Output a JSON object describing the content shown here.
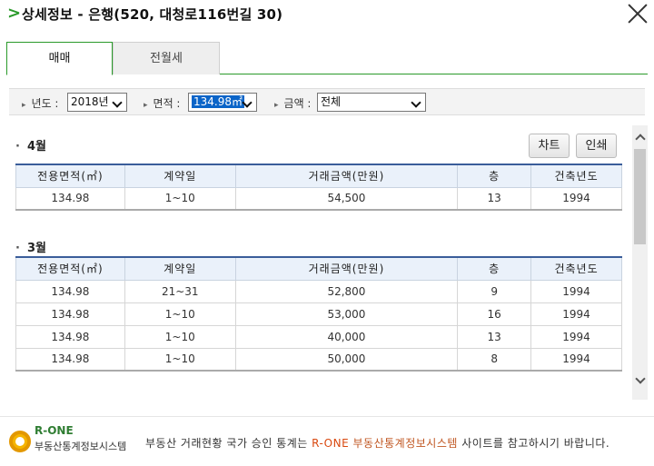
{
  "header": {
    "title": "상세정보 - 은행(520, 대청로116번길 30)"
  },
  "tabs": [
    "매매",
    "전월세"
  ],
  "filters": {
    "year_label": "년도 :",
    "year_value": "2018년",
    "area_label": "면적 :",
    "area_value": "134.98㎡",
    "amount_label": "금액 :",
    "amount_value": "전체"
  },
  "buttons": {
    "chart": "차트",
    "print": "인쇄"
  },
  "table_headers": [
    "전용면적(㎡)",
    "계약일",
    "거래금액(만원)",
    "층",
    "건축년도"
  ],
  "sections": [
    {
      "month": "4월",
      "rows": [
        [
          "134.98",
          "1~10",
          "54,500",
          "13",
          "1994"
        ]
      ]
    },
    {
      "month": "3월",
      "rows": [
        [
          "134.98",
          "21~31",
          "52,800",
          "9",
          "1994"
        ],
        [
          "134.98",
          "1~10",
          "53,000",
          "16",
          "1994"
        ],
        [
          "134.98",
          "1~10",
          "40,000",
          "13",
          "1994"
        ],
        [
          "134.98",
          "1~10",
          "50,000",
          "8",
          "1994"
        ]
      ]
    }
  ],
  "footer": {
    "logo_brand": "R-ONE",
    "logo_name": "부동산통계정보시스템",
    "notice_pre": "부동산 거래현황 국가 승인 통계는",
    "notice_brand": "R-ONE",
    "notice_system": "부동산통계정보시스템",
    "notice_post": "사이트를 참고하시기 바랍니다."
  },
  "colors": {
    "accent_green": "#2a9a2a",
    "table_header_bg": "#eaf1fa",
    "selection_blue": "#0a64c8",
    "brand_orange": "#d9480f"
  }
}
